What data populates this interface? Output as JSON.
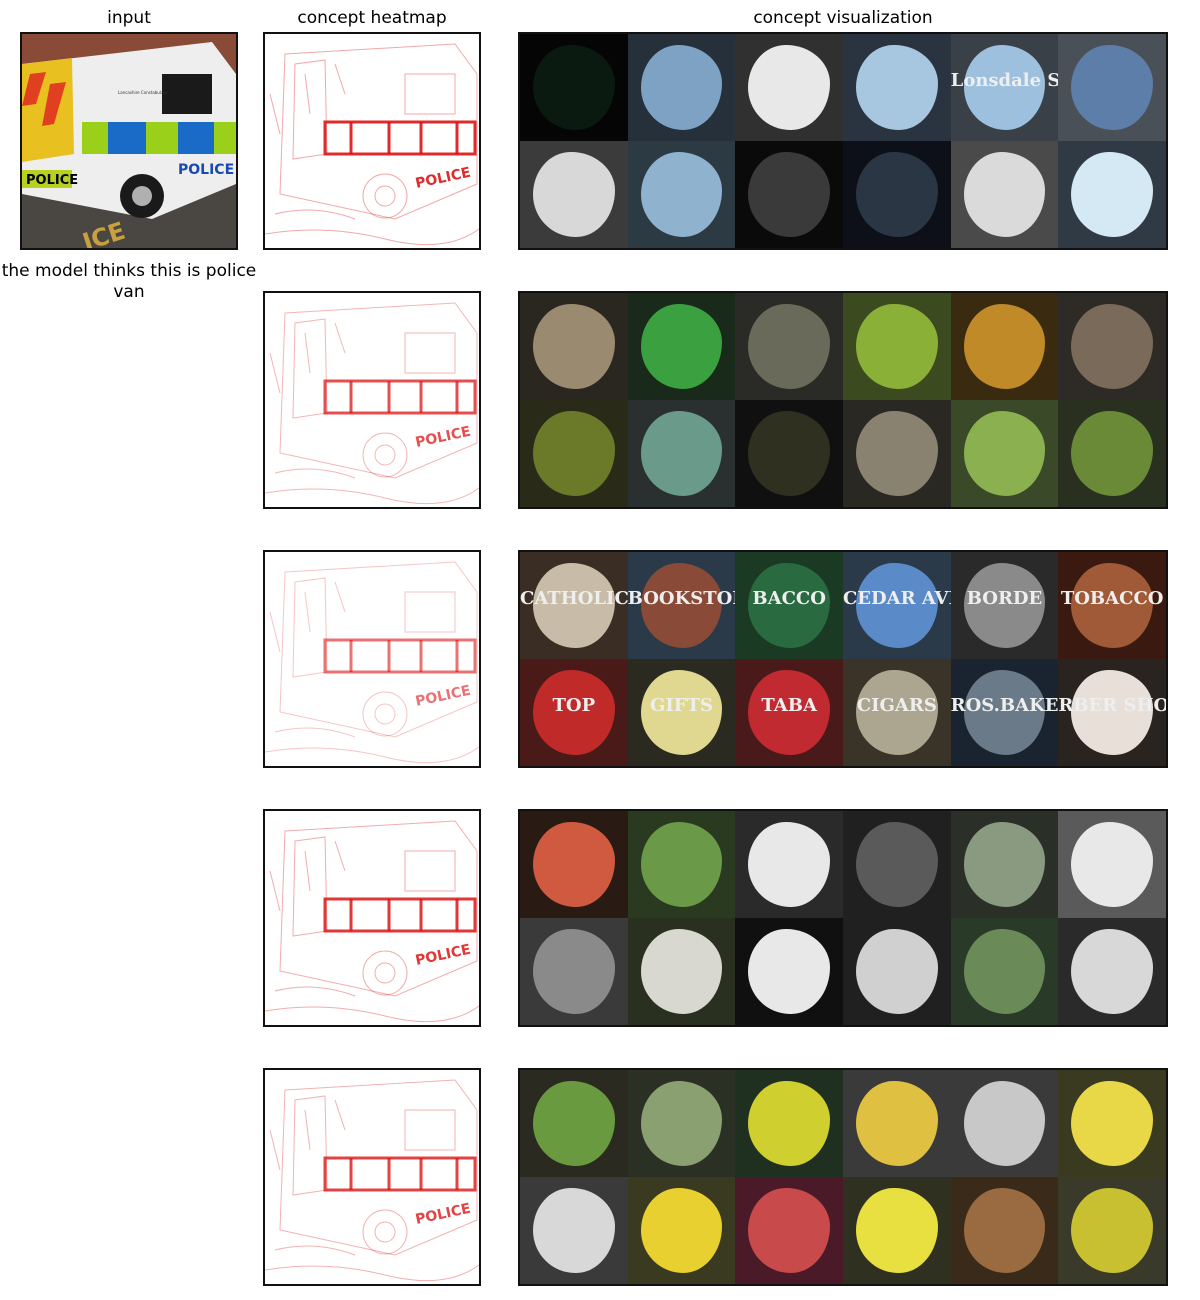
{
  "titles": {
    "input": "input",
    "heatmap": "concept heatmap",
    "visualization": "concept visualization"
  },
  "caption": "the model thinks this is police van",
  "input_image": {
    "van_text": "POLICE",
    "side_text": "POLICE",
    "badge_text": "Lancashire Constabulary",
    "road_text": "ICE"
  },
  "heatmaps": [
    {
      "van_text": "POLICE"
    },
    {
      "van_text": "POLICE"
    },
    {
      "van_text": "POLICE"
    },
    {
      "van_text": "POLICE"
    },
    {
      "van_text": "POLICE"
    }
  ],
  "concepts": [
    {
      "tiles": [
        {
          "bg": "#050505",
          "blob": "#0a1a10",
          "text": ""
        },
        {
          "bg": "#25303a",
          "blob": "#7da2c4",
          "text": ""
        },
        {
          "bg": "#303030",
          "blob": "#e8e8e8",
          "text": ""
        },
        {
          "bg": "#2a3440",
          "blob": "#a7c6e0",
          "text": ""
        },
        {
          "bg": "#3a4048",
          "blob": "#9cc0de",
          "text": "Lonsdale St"
        },
        {
          "bg": "#4a5058",
          "blob": "#5d7ea8",
          "text": ""
        },
        {
          "bg": "#3b3b3b",
          "blob": "#d8d8d8",
          "text": ""
        },
        {
          "bg": "#2c3a44",
          "blob": "#8fb3cf",
          "text": ""
        },
        {
          "bg": "#0a0a0a",
          "blob": "#3a3a3a",
          "text": ""
        },
        {
          "bg": "#0d1018",
          "blob": "#2a3644",
          "text": ""
        },
        {
          "bg": "#4a4a4a",
          "blob": "#dadada",
          "text": ""
        },
        {
          "bg": "#303a44",
          "blob": "#d5e9f5",
          "text": ""
        }
      ]
    },
    {
      "tiles": [
        {
          "bg": "#2a2620",
          "blob": "#9a8a70",
          "text": ""
        },
        {
          "bg": "#1a2a1a",
          "blob": "#3aa040",
          "text": ""
        },
        {
          "bg": "#2a2a26",
          "blob": "#6a6a5a",
          "text": ""
        },
        {
          "bg": "#3c4a20",
          "blob": "#8ab038",
          "text": ""
        },
        {
          "bg": "#3a2a10",
          "blob": "#c08a28",
          "text": ""
        },
        {
          "bg": "#2e2a26",
          "blob": "#7a6a5a",
          "text": ""
        },
        {
          "bg": "#2a2a18",
          "blob": "#6a7a28",
          "text": ""
        },
        {
          "bg": "#2a3030",
          "blob": "#6a9a8a",
          "text": ""
        },
        {
          "bg": "#101010",
          "blob": "#303020",
          "text": ""
        },
        {
          "bg": "#2a2822",
          "blob": "#8a8270",
          "text": ""
        },
        {
          "bg": "#3a4a28",
          "blob": "#8ab050",
          "text": ""
        },
        {
          "bg": "#2a3020",
          "blob": "#6a8a38",
          "text": ""
        }
      ]
    },
    {
      "tiles": [
        {
          "bg": "#3a2e24",
          "blob": "#c8bca8",
          "text": "CATHOLIC"
        },
        {
          "bg": "#2a3a48",
          "blob": "#8a4a38",
          "text": "BOOKSTORE"
        },
        {
          "bg": "#1a3a24",
          "blob": "#2a6a40",
          "text": "BACCO"
        },
        {
          "bg": "#2a3a48",
          "blob": "#5a8ac8",
          "text": "CEDAR AVE"
        },
        {
          "bg": "#2a2a2a",
          "blob": "#8a8a8a",
          "text": "BORDE"
        },
        {
          "bg": "#3a1a10",
          "blob": "#a05a38",
          "text": "TOBACCO"
        },
        {
          "bg": "#4a1a18",
          "blob": "#c02a28",
          "text": "TOP"
        },
        {
          "bg": "#2a2a20",
          "blob": "#e0d890",
          "text": "GIFTS"
        },
        {
          "bg": "#4a1a1a",
          "blob": "#c02a30",
          "text": "TABA"
        },
        {
          "bg": "#3a3428",
          "blob": "#aca690",
          "text": "CIGARS"
        },
        {
          "bg": "#1a2430",
          "blob": "#6a7a88",
          "text": "ROS.BAKERY"
        },
        {
          "bg": "#2a2420",
          "blob": "#e8e0d8",
          "text": "RBER SHOP"
        }
      ]
    },
    {
      "tiles": [
        {
          "bg": "#2a1a14",
          "blob": "#d05a40",
          "text": ""
        },
        {
          "bg": "#2a3a20",
          "blob": "#6a9a48",
          "text": ""
        },
        {
          "bg": "#2a2a2a",
          "blob": "#e8e8e8",
          "text": ""
        },
        {
          "bg": "#202020",
          "blob": "#5a5a5a",
          "text": ""
        },
        {
          "bg": "#2a3028",
          "blob": "#8a9a80",
          "text": ""
        },
        {
          "bg": "#5a5a5a",
          "blob": "#e8e8e8",
          "text": ""
        },
        {
          "bg": "#3a3a3a",
          "blob": "#8a8a8a",
          "text": ""
        },
        {
          "bg": "#2a3020",
          "blob": "#d8d8d0",
          "text": ""
        },
        {
          "bg": "#101010",
          "blob": "#e8e8e8",
          "text": ""
        },
        {
          "bg": "#202020",
          "blob": "#d0d0d0",
          "text": ""
        },
        {
          "bg": "#2a3a28",
          "blob": "#6a8a58",
          "text": ""
        },
        {
          "bg": "#2a2a2a",
          "blob": "#d8d8d8",
          "text": ""
        }
      ]
    },
    {
      "tiles": [
        {
          "bg": "#2a2a20",
          "blob": "#6a9a40",
          "text": ""
        },
        {
          "bg": "#2a3024",
          "blob": "#8aa070",
          "text": ""
        },
        {
          "bg": "#203020",
          "blob": "#cfcf30",
          "text": ""
        },
        {
          "bg": "#3a3a3a",
          "blob": "#e0c040",
          "text": ""
        },
        {
          "bg": "#3a3a3a",
          "blob": "#c8c8c8",
          "text": ""
        },
        {
          "bg": "#3a3a20",
          "blob": "#e8d848",
          "text": ""
        },
        {
          "bg": "#3a3a3a",
          "blob": "#d8d8d8",
          "text": ""
        },
        {
          "bg": "#3a3a20",
          "blob": "#e8d030",
          "text": ""
        },
        {
          "bg": "#4a1a28",
          "blob": "#c84a4a",
          "text": ""
        },
        {
          "bg": "#303020",
          "blob": "#e8e040",
          "text": ""
        },
        {
          "bg": "#3a2a1a",
          "blob": "#9a6a40",
          "text": ""
        },
        {
          "bg": "#3a3a2a",
          "blob": "#c8c030",
          "text": ""
        }
      ]
    }
  ]
}
